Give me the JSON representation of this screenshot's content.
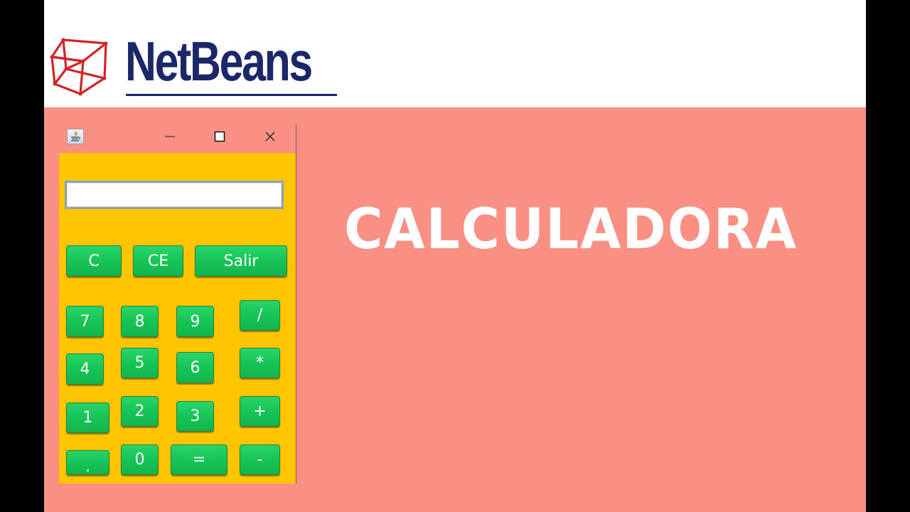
{
  "header": {
    "logo_text": "NetBeans",
    "logo_icon": "netbeans-cube-icon"
  },
  "slide": {
    "title": "CALCULADORA"
  },
  "colors": {
    "slide_background": "#fa9084",
    "header_background": "#ffffff",
    "logo_blue": "#1b2768",
    "logo_red": "#d2232a",
    "panel_yellow": "#ffc600",
    "button_green": "#17c456",
    "button_text": "#ffffff",
    "title_text": "#ffffff"
  },
  "window": {
    "app_icon": "java-coffee-icon",
    "controls": {
      "minimize": "minimize-icon",
      "maximize": "maximize-icon",
      "close": "close-icon"
    }
  },
  "calculator": {
    "display_value": "",
    "buttons": {
      "clear": "C",
      "clear_entry": "CE",
      "exit": "Salir",
      "seven": "7",
      "eight": "8",
      "nine": "9",
      "divide": "/",
      "four": "4",
      "five": "5",
      "six": "6",
      "multiply": "*",
      "one": "1",
      "two": "2",
      "three": "3",
      "add": "+",
      "decimal": ".",
      "zero": "0",
      "equals": "=",
      "subtract": "-"
    }
  }
}
